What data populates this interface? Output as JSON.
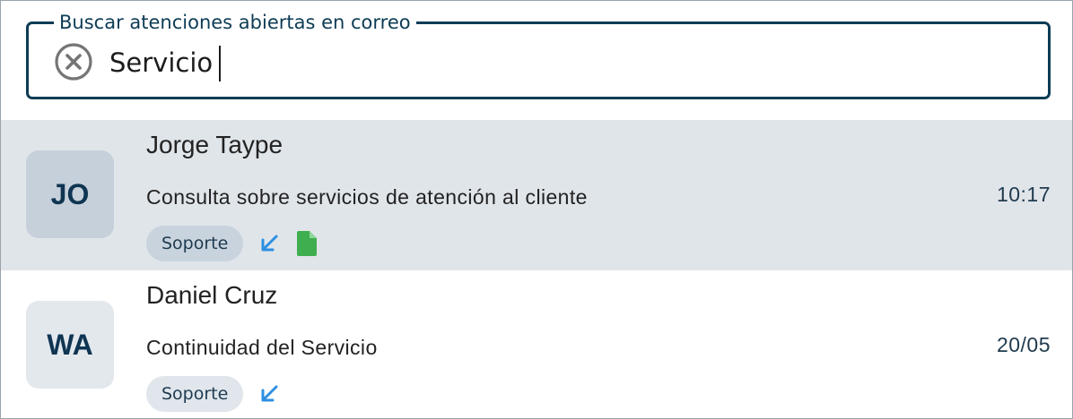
{
  "search": {
    "legend": "Buscar atenciones abiertas en correo",
    "value": "Servicio"
  },
  "icons": {
    "clear": "close-circle-icon",
    "incoming": "arrow-down-left-icon",
    "attachment": "document-icon"
  },
  "colors": {
    "accent": "#0d3c55",
    "selected_row": "#e0e5ea",
    "arrow": "#2e8fe0",
    "attachment": "#3fae4f"
  },
  "messages": [
    {
      "initials": "JO",
      "name": "Jorge Taype",
      "subject": "Consulta sobre servicios de atención al cliente",
      "time": "10:17",
      "tag": "Soporte",
      "selected": true,
      "has_attachment": true
    },
    {
      "initials": "WA",
      "name": "Daniel Cruz",
      "subject": "Continuidad del Servicio",
      "time": "20/05",
      "tag": "Soporte",
      "selected": false,
      "has_attachment": false
    }
  ]
}
